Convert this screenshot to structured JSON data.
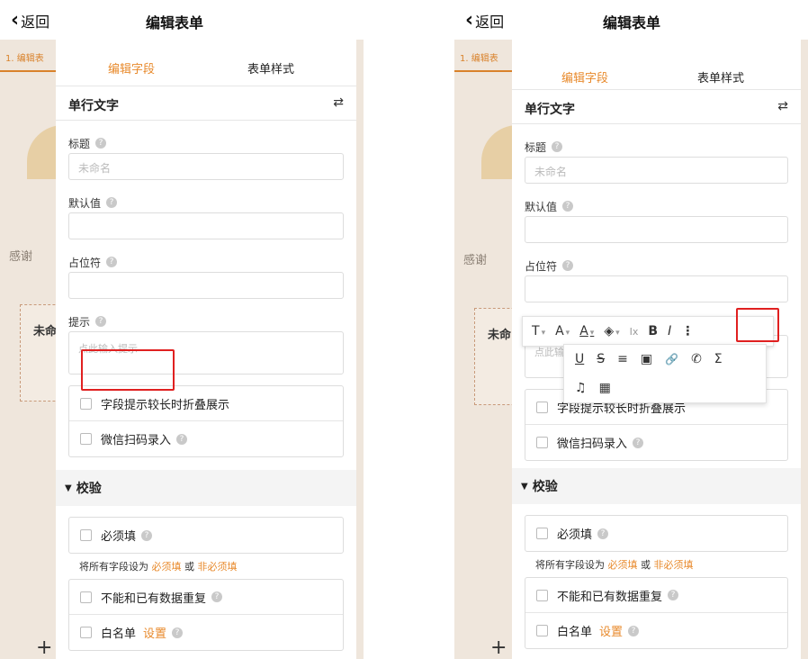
{
  "left": {
    "back_label": "返回",
    "title": "编辑表单",
    "bg_tab": "1. 编辑表",
    "bg_text": "感谢",
    "bg_item": "未命",
    "tabs": [
      "编辑字段",
      "表单样式"
    ],
    "field_type": "单行文字",
    "title_label": "标题",
    "title_placeholder": "未命名",
    "default_label": "默认值",
    "placeholder_label": "占位符",
    "hint_label": "提示",
    "hint_placeholder": "点此输入提示",
    "options": [
      "字段提示较长时折叠展示",
      "微信扫码录入"
    ],
    "validation": "校验",
    "required": "必须填",
    "note_prefix": "将所有字段设为",
    "note_required": "必须填",
    "note_or": "或",
    "note_optional": "非必须填",
    "no_dup": "不能和已有数据重复",
    "whitelist": "白名单",
    "whitelist_set": "设置"
  },
  "right": {
    "back_label": "返回",
    "title": "编辑表单",
    "bg_tab": "1. 编辑表",
    "bg_text": "感谢",
    "bg_item": "未命",
    "tabs": [
      "编辑字段",
      "表单样式"
    ],
    "field_type": "单行文字",
    "title_label": "标题",
    "title_placeholder": "未命名",
    "default_label": "默认值",
    "placeholder_label": "占位符",
    "hint_partial": "点此输",
    "options": [
      "字段提示较长时折叠展示",
      "微信扫码录入"
    ],
    "validation": "校验",
    "required": "必须填",
    "note_prefix": "将所有字段设为",
    "note_required": "必须填",
    "note_or": "或",
    "note_optional": "非必须填",
    "no_dup": "不能和已有数据重复",
    "whitelist": "白名单",
    "whitelist_set": "设置",
    "toolbar_row1": [
      "T",
      "A",
      "A",
      "◈",
      "Ix",
      "B",
      "I"
    ],
    "toolbar_more": "⋮",
    "toolbar_row2": [
      "U",
      "S",
      "≡",
      "▣",
      "🔗",
      "✆",
      "Σ"
    ],
    "toolbar_row3": [
      "♫",
      "▦"
    ]
  },
  "colors": {
    "accent": "#e88a2c",
    "highlight": "#e02020"
  }
}
